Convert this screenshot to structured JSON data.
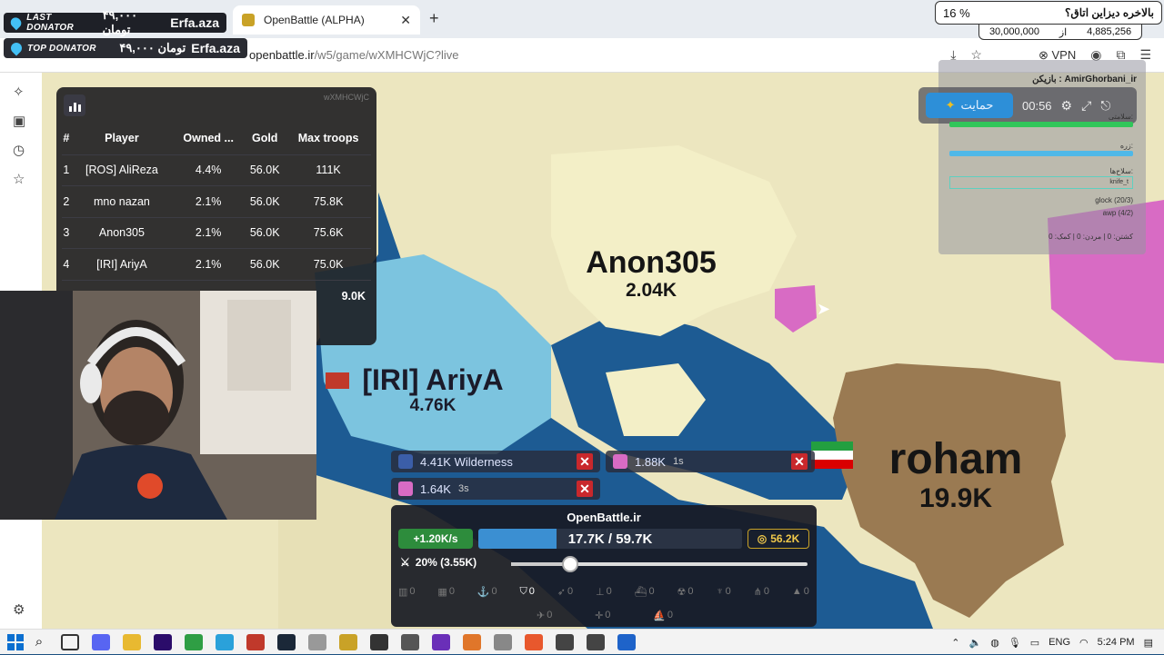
{
  "browser": {
    "tab_title": "OpenBattle (ALPHA)",
    "tab_close": "✕",
    "new_tab": "+",
    "url_host": "openbattle.ir",
    "url_path": "/w5/game/wXMHCWjC?live",
    "vpn_label": "VPN"
  },
  "donors": {
    "last_label": "LAST DONATOR",
    "last_amount": "۴۹,۰۰۰ تومان",
    "last_name": "Erfa.aza",
    "top_label": "TOP DONATOR",
    "top_amount": "۴۹,۰۰۰ تومان",
    "top_name": "Erfa.aza"
  },
  "poll": {
    "question": "بالاخره دیزاین اتاق؟",
    "percent": "16 %",
    "current": "4,885,256",
    "of": "از",
    "goal": "30,000,000"
  },
  "leaderboard": {
    "game_id": "wXMHCWjC",
    "headers": [
      "#",
      "Player",
      "Owned ...",
      "Gold",
      "Max troops"
    ],
    "rows": [
      {
        "rank": "1",
        "player": "[ROS] AliReza",
        "owned": "4.4%",
        "gold": "56.0K",
        "troops": "111K"
      },
      {
        "rank": "2",
        "player": "mno nazan",
        "owned": "2.1%",
        "gold": "56.0K",
        "troops": "75.8K"
      },
      {
        "rank": "3",
        "player": "Anon305",
        "owned": "2.1%",
        "gold": "56.0K",
        "troops": "75.6K"
      },
      {
        "rank": "4",
        "player": "[IRI] AriyA",
        "owned": "2.1%",
        "gold": "56.0K",
        "troops": "75.0K"
      }
    ],
    "partial_value": "9.0K"
  },
  "map": {
    "players": [
      {
        "name": "Anon305",
        "troops": "2.04K"
      },
      {
        "name": "[IRI] AriyA",
        "troops": "4.76K"
      },
      {
        "name": "roham",
        "troops": "19.9K"
      }
    ],
    "colors": {
      "ocean": "#1d5b93",
      "land": "#ece6bf",
      "anon": "#f3efc7",
      "ariya": "#7cc4df",
      "roham": "#9a7a52",
      "pink": "#d86bc4"
    }
  },
  "game_panel": {
    "player_label": "بازیکن : AmirGhorbani_ir",
    "support_label": "حمایت",
    "timer": "00:56",
    "hp_label": "سلامتی:",
    "armor_label": "زره:",
    "weapons_label": "سلاح‌ها:",
    "weapon_current": "knife_t",
    "weapon_2": "glock (20/3)",
    "weapon_3": "awp (4/2)",
    "stats": "کشتن: 0 | مردن: 0 | کمک: 0"
  },
  "attacks": [
    {
      "label": "4.41K Wilderness",
      "time": ""
    },
    {
      "label": "1.88K",
      "time": "1s"
    },
    {
      "label": "1.64K",
      "time": "3s"
    }
  ],
  "control": {
    "title": "OpenBattle.ir",
    "rate": "+1.20K/s",
    "troops": "17.7K / 59.7K",
    "troop_fraction": 0.297,
    "gold": "56.2K",
    "ratio": "20% (3.55K)",
    "slider_fraction": 0.2,
    "build_counts": [
      "0",
      "0",
      "0",
      "0",
      "0",
      "0",
      "0",
      "0",
      "0",
      "0",
      "0"
    ],
    "unit_counts": [
      "0",
      "0",
      "0"
    ]
  },
  "taskbar": {
    "lang": "ENG",
    "time": "5:24 PM"
  }
}
